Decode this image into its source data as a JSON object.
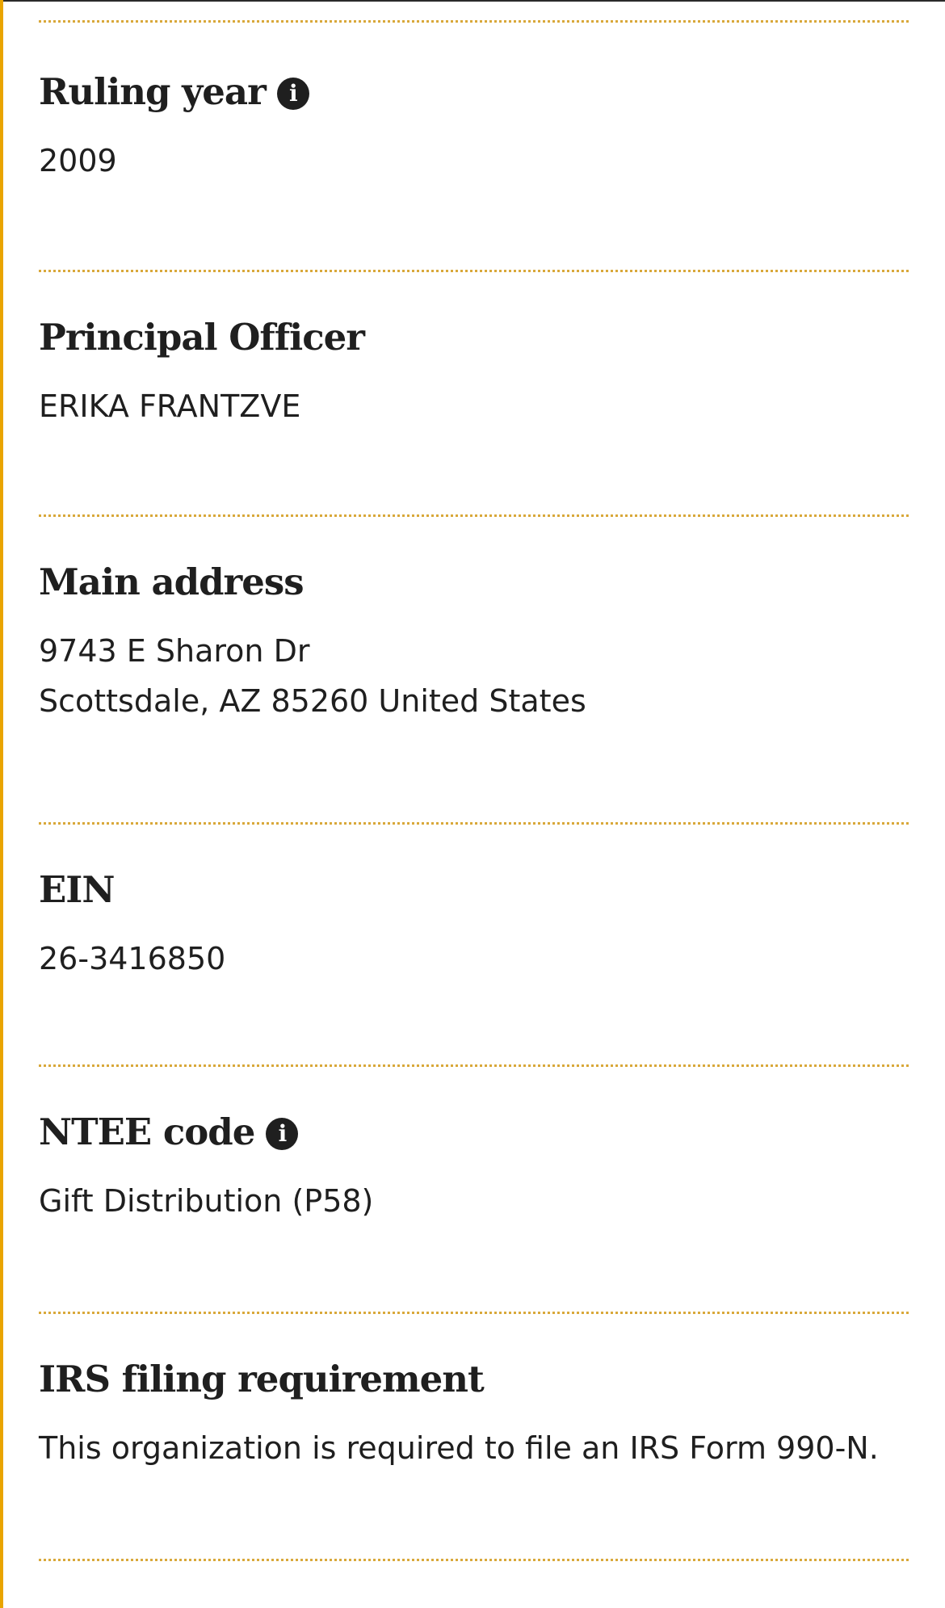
{
  "sections": [
    {
      "heading": "Ruling year",
      "has_info": true,
      "lines": [
        "2009"
      ]
    },
    {
      "heading": "Principal Officer",
      "has_info": false,
      "lines": [
        "ERIKA FRANTZVE"
      ]
    },
    {
      "heading": "Main address",
      "has_info": false,
      "lines": [
        "9743 E Sharon Dr",
        "Scottsdale, AZ 85260 United States"
      ]
    },
    {
      "heading": "EIN",
      "has_info": false,
      "lines": [
        "26-3416850"
      ]
    },
    {
      "heading": "NTEE code",
      "has_info": true,
      "lines": [
        "Gift Distribution (P58)"
      ]
    },
    {
      "heading": "IRS filing requirement",
      "has_info": false,
      "lines": [
        "This organization is required to file an IRS Form 990-N."
      ]
    }
  ],
  "icons": {
    "info": "info-icon"
  },
  "colors": {
    "accent": "#e9a400",
    "divider": "#d9a83a",
    "text": "#1f1f1f"
  }
}
